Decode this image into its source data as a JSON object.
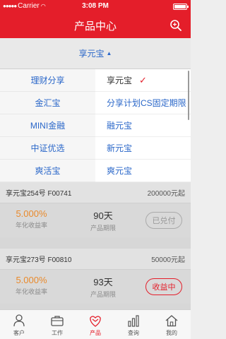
{
  "status_bar": {
    "carrier": "Carrier",
    "time": "3:08 PM"
  },
  "nav": {
    "title": "产品中心",
    "search_icon": "search-icon"
  },
  "filter": {
    "selected": "享元宝"
  },
  "dropdown": {
    "left": [
      {
        "label": "理财分享",
        "active": true
      },
      {
        "label": "金汇宝",
        "active": false
      },
      {
        "label": "MINI金融",
        "active": false
      },
      {
        "label": "中证优选",
        "active": false
      },
      {
        "label": "爽活宝",
        "active": false
      }
    ],
    "right": [
      {
        "label": "享元宝",
        "selected": true
      },
      {
        "label": "分享计划CS固定期限",
        "selected": false
      },
      {
        "label": "融元宝",
        "selected": false
      },
      {
        "label": "新元宝",
        "selected": false
      },
      {
        "label": "爽元宝",
        "selected": false
      }
    ]
  },
  "products": [
    {
      "name": "享元宝254号 F00741",
      "amount": "200000元起",
      "rate": "5.000%",
      "rate_label": "年化收益率",
      "term": "90天",
      "term_label": "产品期限",
      "status": "已兑付",
      "status_active": false
    },
    {
      "name": "享元宝273号 F00810",
      "amount": "50000元起",
      "rate": "5.000%",
      "rate_label": "年化收益率",
      "term": "93天",
      "term_label": "产品期限",
      "status": "收益中",
      "status_active": true
    }
  ],
  "tabs": [
    {
      "label": "客户",
      "icon": "person-icon",
      "active": false
    },
    {
      "label": "工作",
      "icon": "briefcase-icon",
      "active": false
    },
    {
      "label": "产品",
      "icon": "product-icon",
      "active": true
    },
    {
      "label": "查询",
      "icon": "chart-icon",
      "active": false
    },
    {
      "label": "我的",
      "icon": "home-icon",
      "active": false
    }
  ],
  "colors": {
    "brand_red": "#e41e2a",
    "link_blue": "#2a67c9",
    "rate_orange": "#e98a2c"
  }
}
